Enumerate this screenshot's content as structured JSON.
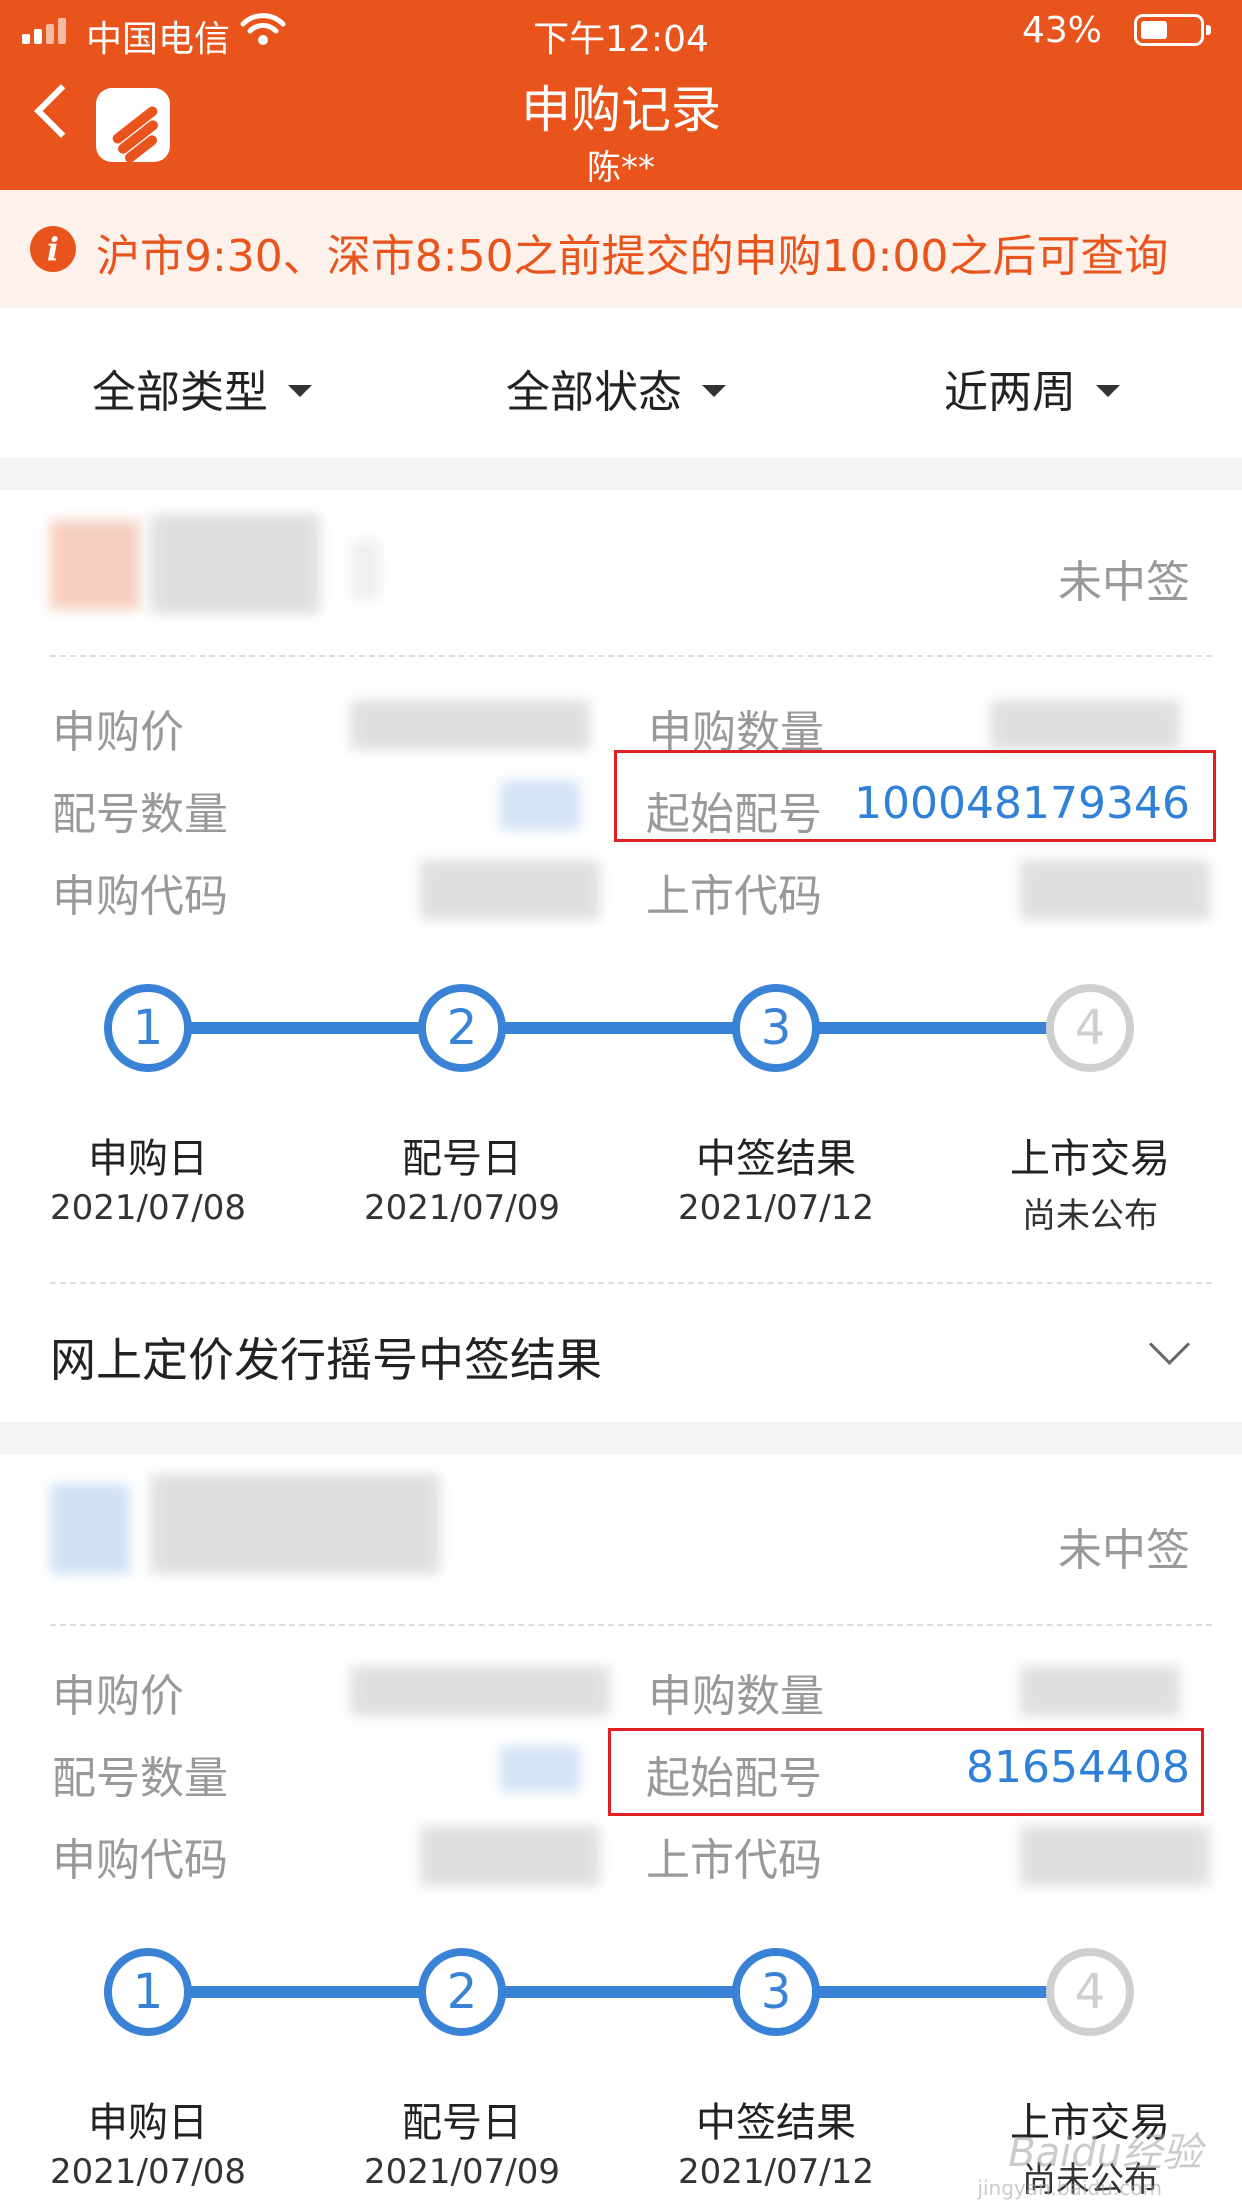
{
  "status_bar": {
    "carrier": "中国电信",
    "time": "下午12:04",
    "battery": "43%"
  },
  "nav": {
    "title": "申购记录",
    "subtitle": "陈**",
    "back_icon": "chevron-left-icon",
    "logo_icon": "app-logo-icon"
  },
  "notice": {
    "icon": "info-icon",
    "icon_glyph": "i",
    "text": "沪市9:30、深市8:50之前提交的申购10:00之后可查询"
  },
  "filters": [
    {
      "label": "全部类型"
    },
    {
      "label": "全部状态"
    },
    {
      "label": "近两周"
    }
  ],
  "records": [
    {
      "status": "未中签",
      "fields": {
        "price_label": "申购价",
        "quantity_label": "申购数量",
        "match_count_label": "配号数量",
        "start_no_label": "起始配号",
        "start_no": "100048179346",
        "sub_code_label": "申购代码",
        "list_code_label": "上市代码"
      },
      "steps": [
        {
          "num": "1",
          "label": "申购日",
          "date": "2021/07/08"
        },
        {
          "num": "2",
          "label": "配号日",
          "date": "2021/07/09"
        },
        {
          "num": "3",
          "label": "中签结果",
          "date": "2021/07/12"
        },
        {
          "num": "4",
          "label": "上市交易",
          "date": "尚未公布"
        }
      ],
      "result_title": "网上定价发行摇号中签结果"
    },
    {
      "status": "未中签",
      "fields": {
        "price_label": "申购价",
        "quantity_label": "申购数量",
        "match_count_label": "配号数量",
        "start_no_label": "起始配号",
        "start_no": "81654408",
        "sub_code_label": "申购代码",
        "list_code_label": "上市代码"
      },
      "steps": [
        {
          "num": "1",
          "label": "申购日",
          "date": "2021/07/08"
        },
        {
          "num": "2",
          "label": "配号日",
          "date": "2021/07/09"
        },
        {
          "num": "3",
          "label": "中签结果",
          "date": "2021/07/12"
        },
        {
          "num": "4",
          "label": "上市交易",
          "date": "尚未公布"
        }
      ]
    }
  ],
  "watermark": {
    "text": "Baidu经验",
    "sub": "jingyan.baidu.com"
  }
}
